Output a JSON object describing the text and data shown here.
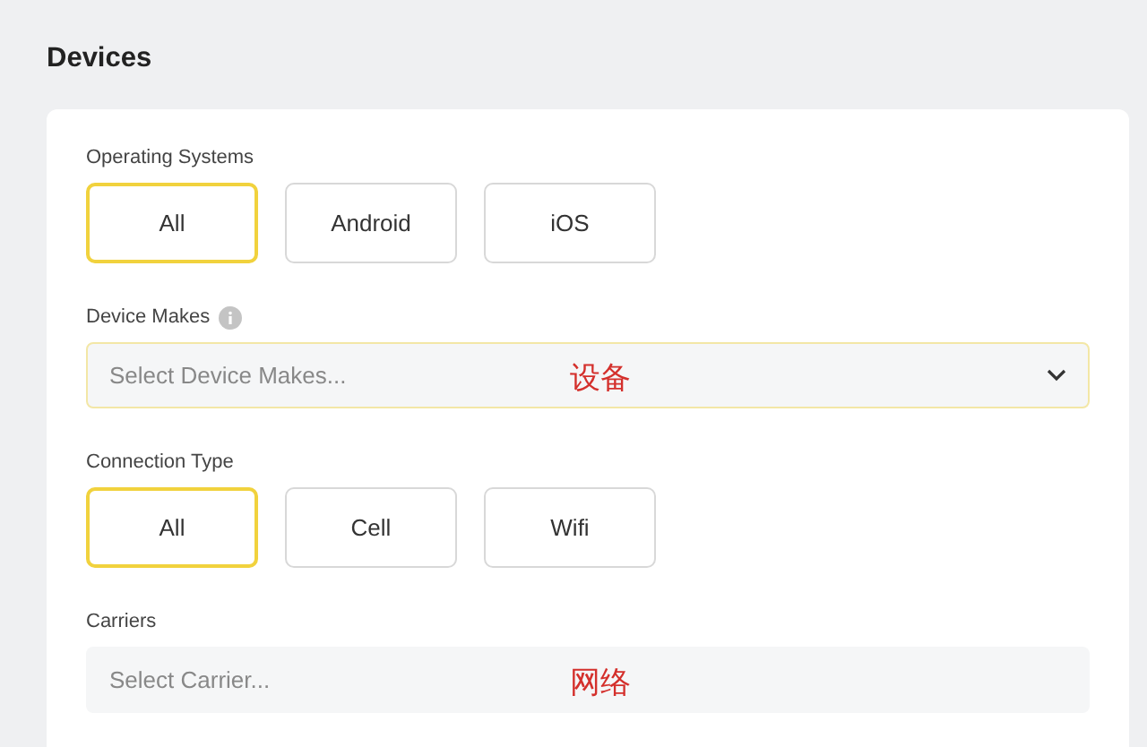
{
  "title": "Devices",
  "groups": [
    {
      "kind": "buttons",
      "label": "Operating Systems",
      "options": [
        {
          "label": "All",
          "selected": true
        },
        {
          "label": "Android",
          "selected": false
        },
        {
          "label": "iOS",
          "selected": false
        }
      ]
    },
    {
      "kind": "select",
      "label": "Device Makes",
      "info": true,
      "placeholder": "Select Device Makes...",
      "focused": true,
      "caret": true,
      "annotation": "设备"
    },
    {
      "kind": "buttons",
      "label": "Connection Type",
      "options": [
        {
          "label": "All",
          "selected": true
        },
        {
          "label": "Cell",
          "selected": false
        },
        {
          "label": "Wifi",
          "selected": false
        }
      ]
    },
    {
      "kind": "select",
      "label": "Carriers",
      "info": false,
      "placeholder": "Select Carrier...",
      "focused": false,
      "caret": false,
      "annotation": "网络"
    }
  ]
}
